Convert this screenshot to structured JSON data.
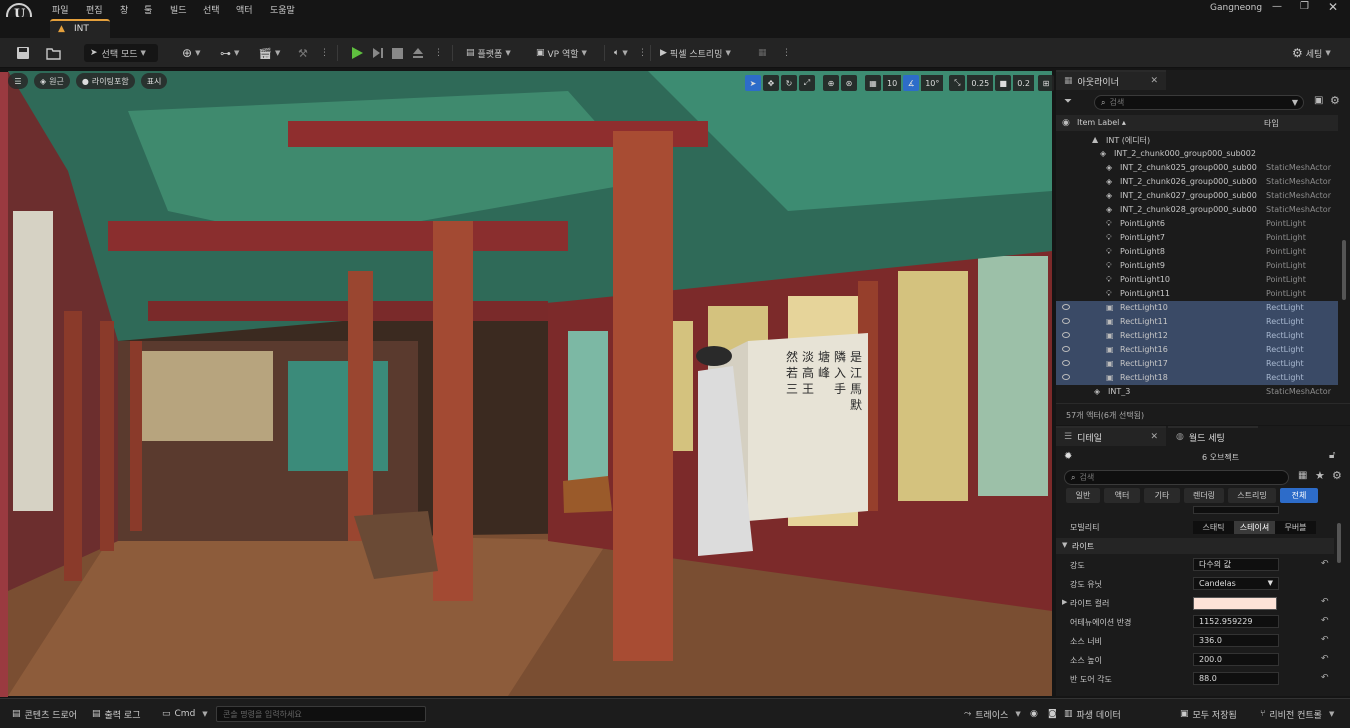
{
  "menubar": {
    "items": [
      "파일",
      "편집",
      "창",
      "툴",
      "빌드",
      "선택",
      "액터",
      "도움말"
    ],
    "project_name": "Gangneong"
  },
  "tab": {
    "title": "INT"
  },
  "toolbar": {
    "select_mode": "선택 모드",
    "platforms": "플랫폼",
    "vp_role": "VP 역할",
    "pixel_streaming": "픽셀 스트리밍",
    "settings": "세팅"
  },
  "viewport": {
    "perspective": "원근",
    "lighting": "라이팅포함",
    "show": "표시",
    "grid_snap": "10",
    "angle_snap": "10°",
    "scale_snap": "0.25",
    "camera_speed": "0.2",
    "screen_calligraphy": [
      "然",
      "若",
      "三",
      "淡",
      "高",
      "王",
      "塘",
      "峰",
      "隣",
      "入",
      "手",
      "是",
      "江",
      "馬",
      "默"
    ]
  },
  "outliner": {
    "tab_label": "아웃라이너",
    "search_placeholder": "검색",
    "col_label": "Item Label ▴",
    "col_type": "타입",
    "rows": [
      {
        "label": "INT (에디터)",
        "type": ""
      },
      {
        "label": "INT_2_chunk000_group000_sub002",
        "type": ""
      },
      {
        "label": "INT_2_chunk025_group000_sub00",
        "type": "StaticMeshActor"
      },
      {
        "label": "INT_2_chunk026_group000_sub00",
        "type": "StaticMeshActor"
      },
      {
        "label": "INT_2_chunk027_group000_sub00",
        "type": "StaticMeshActor"
      },
      {
        "label": "INT_2_chunk028_group000_sub00",
        "type": "StaticMeshActor"
      },
      {
        "label": "PointLight6",
        "type": "PointLight"
      },
      {
        "label": "PointLight7",
        "type": "PointLight"
      },
      {
        "label": "PointLight8",
        "type": "PointLight"
      },
      {
        "label": "PointLight9",
        "type": "PointLight"
      },
      {
        "label": "PointLight10",
        "type": "PointLight"
      },
      {
        "label": "PointLight11",
        "type": "PointLight"
      },
      {
        "label": "RectLight10",
        "type": "RectLight"
      },
      {
        "label": "RectLight11",
        "type": "RectLight"
      },
      {
        "label": "RectLight12",
        "type": "RectLight"
      },
      {
        "label": "RectLight16",
        "type": "RectLight"
      },
      {
        "label": "RectLight17",
        "type": "RectLight"
      },
      {
        "label": "RectLight18",
        "type": "RectLight"
      },
      {
        "label": "INT_3",
        "type": "StaticMeshActor"
      }
    ],
    "status": "57개 액터(6개 선택됨)"
  },
  "details": {
    "tab_label": "디테일",
    "world_tab_label": "월드 세팅",
    "object_count": "6 오브젝트",
    "search_placeholder": "검색",
    "filter_tabs": [
      "일반",
      "액터",
      "기타",
      "렌더링",
      "스트리밍",
      "전체"
    ],
    "mobility_label": "모빌리티",
    "mobility_options": [
      "스태틱",
      "스테이셔",
      "무버블"
    ],
    "section": "라이트",
    "props": [
      {
        "label": "강도",
        "value": "다수의 값"
      },
      {
        "label": "강도 유닛",
        "value": "Candelas"
      },
      {
        "label": "라이트 컬러",
        "value": ""
      },
      {
        "label": "어테뉴에이션 반경",
        "value": "1152.959229"
      },
      {
        "label": "소스 너비",
        "value": "336.0"
      },
      {
        "label": "소스 높이",
        "value": "200.0"
      },
      {
        "label": "반 도어 각도",
        "value": "88.0"
      }
    ],
    "light_color": "#fde3d8"
  },
  "bottombar": {
    "content_drawer": "콘텐츠 드로어",
    "output_log": "출력 로그",
    "cmd": "Cmd",
    "console_placeholder": "콘솔 명령을 입력하세요",
    "trace": "트레이스",
    "derived_data": "파생 데이터",
    "save_all": "모두 저장됨",
    "revision_control": "리비전 컨트롤"
  }
}
